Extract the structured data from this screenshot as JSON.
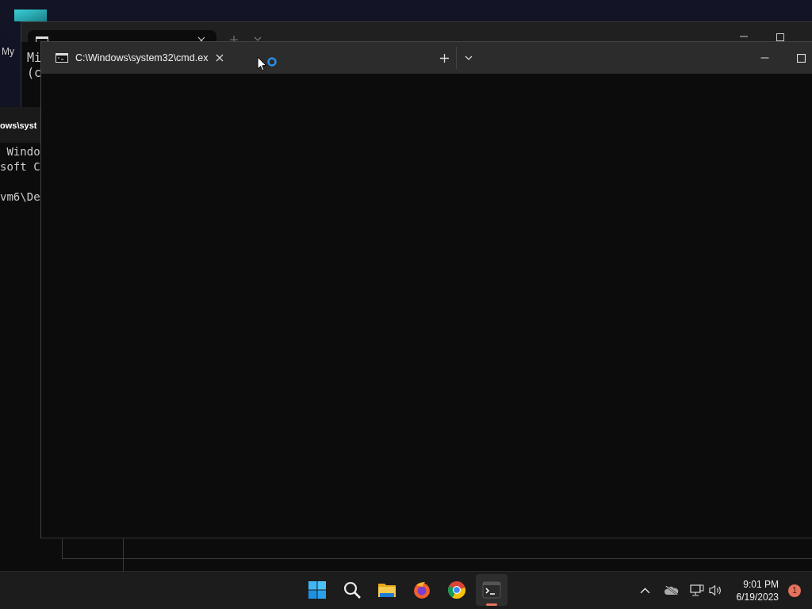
{
  "desktop": {
    "icons": [
      {
        "label": "My"
      }
    ]
  },
  "back_window": {
    "lines": [
      "Mi",
      "(c"
    ]
  },
  "side_window": {
    "title": "ows\\syst",
    "blocks": [
      [
        " Windo",
        "soft C"
      ],
      [
        "vm6\\De"
      ]
    ]
  },
  "front_window": {
    "tabs": [
      {
        "title": "C:\\Windows\\system32\\cmd.ex"
      }
    ]
  },
  "cursor": {
    "busy": true
  },
  "taskbar": {
    "apps": [
      {
        "kind": "start",
        "active": false
      },
      {
        "kind": "search",
        "active": false
      },
      {
        "kind": "folder",
        "active": false
      },
      {
        "kind": "fox",
        "active": false
      },
      {
        "kind": "globe",
        "active": false
      },
      {
        "kind": "terminal",
        "active": true
      }
    ],
    "time": "9:01 PM",
    "date": "6/19/2023",
    "notifications": "1"
  }
}
